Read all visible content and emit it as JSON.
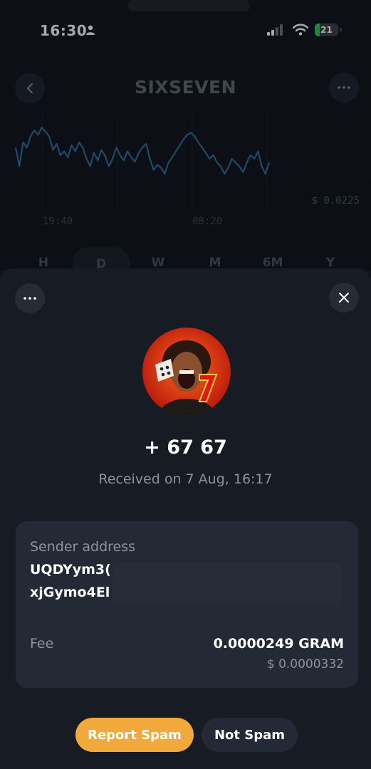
{
  "status": {
    "time": "16:30",
    "battery": "21",
    "battery_level": 0.21
  },
  "header": {
    "title": "SIXSEVEN"
  },
  "chart_data": {
    "type": "line",
    "x_ticks": [
      "19:40",
      "08:20"
    ],
    "price_label": "$ 0.0225",
    "series": [
      {
        "values": [
          0.55,
          0.3,
          0.62,
          0.55,
          0.7,
          0.78,
          0.72,
          0.82,
          0.76,
          0.7,
          0.52,
          0.6,
          0.45,
          0.5,
          0.42,
          0.58,
          0.5,
          0.62,
          0.55,
          0.4,
          0.3,
          0.48,
          0.38,
          0.52,
          0.44,
          0.3,
          0.4,
          0.55,
          0.45,
          0.38,
          0.5,
          0.42,
          0.36,
          0.48,
          0.55,
          0.6,
          0.4,
          0.25,
          0.32,
          0.28,
          0.2,
          0.35,
          0.42,
          0.5,
          0.58,
          0.66,
          0.72,
          0.75,
          0.7,
          0.62,
          0.55,
          0.48,
          0.4,
          0.45,
          0.35,
          0.3,
          0.2,
          0.28,
          0.4,
          0.35,
          0.3,
          0.22,
          0.35,
          0.45,
          0.4,
          0.5,
          0.3,
          0.2,
          0.35
        ]
      }
    ]
  },
  "periods": [
    "H",
    "D",
    "W",
    "M",
    "6M",
    "Y"
  ],
  "active_period": "D",
  "transaction": {
    "amount": "+ 67 67",
    "received": "Received on 7 Aug, 16:17",
    "sender_label": "Sender address",
    "address_line1": "UQDYym3(",
    "address_line2": "xjGymo4El",
    "fee_label": "Fee",
    "fee_value": "0.0000249 GRAM",
    "fee_usd": "$ 0.0000332"
  },
  "buttons": {
    "report_spam": "Report Spam",
    "not_spam": "Not Spam"
  },
  "colors": {
    "accent": "#f2a93b",
    "chart_line": "#2f6c97",
    "battery": "#34c759"
  }
}
